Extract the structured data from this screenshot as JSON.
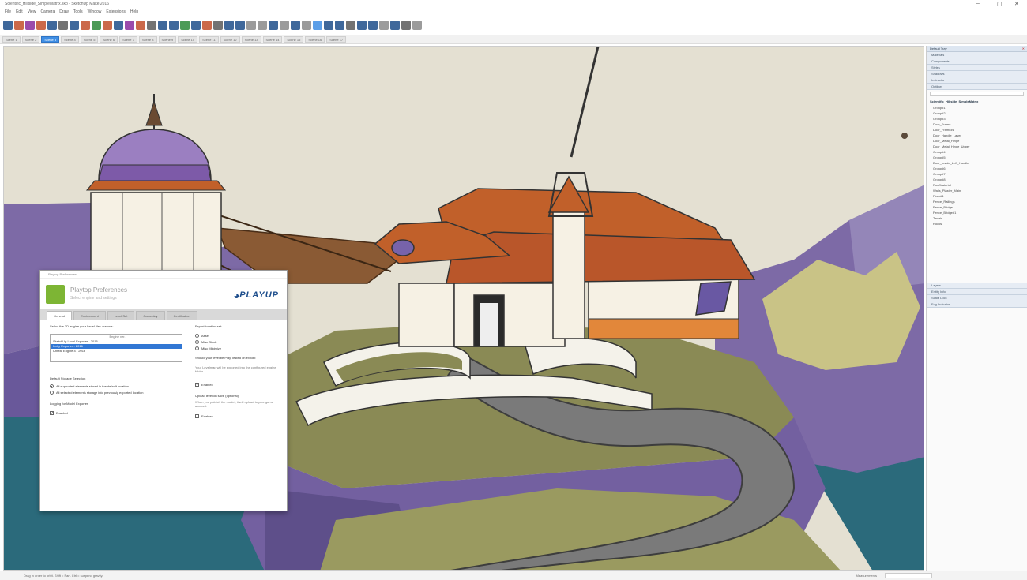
{
  "window": {
    "title": "Scientific_Hillside_SimpleMatrix.skp - SketchUp Make 2016"
  },
  "menu": [
    "File",
    "Edit",
    "View",
    "Camera",
    "Draw",
    "Tools",
    "Window",
    "Extensions",
    "Help"
  ],
  "scenes": {
    "tabs": [
      "Scene 1",
      "Scene 2",
      "Scene 3",
      "Scene 4",
      "Scene 5",
      "Scene 6",
      "Scene 7",
      "Scene 8",
      "Scene 9",
      "Scene 10",
      "Scene 11",
      "Scene 12",
      "Scene 13",
      "Scene 14",
      "Scene 15",
      "Scene 16",
      "Scene 17"
    ],
    "active_index": 2
  },
  "tray": {
    "title": "Default Tray",
    "panels": [
      "Materials",
      "Components",
      "Styles",
      "Shadows",
      "Instructor",
      "Outliner"
    ],
    "outliner_root": "Scientific_Hillside_SimpleMatrix",
    "outliner_items": [
      "Group#1",
      "Group#2",
      "Group#3",
      "Door_Frame",
      "Door_Frame#1",
      "Door_Handle_Layer",
      "Door_Metal_Hinge",
      "Door_Metal_Hinge_Upper",
      "Group#4",
      "Group#5",
      "Door_Inside_Left_Handle",
      "Group#6",
      "Group#7",
      "Group#8",
      "RoofMaterial",
      "Walls_Plaster_Main",
      "Floor#1",
      "Fence_Railings",
      "Fence_Bridge",
      "Fence_Bridge#1",
      "Terrain",
      "Rocks"
    ],
    "bottom_panels": [
      "Layers",
      "Entity Info",
      "Scale Lock",
      "Fog Indicator"
    ]
  },
  "status": {
    "text": "Drag in order to orbit. Shift = Pan. Ctrl = suspend gravity.",
    "measurements_label": "Measurements"
  },
  "dialog": {
    "title": "Playtop Preferences",
    "heading": "Playtop Preferences",
    "subheading": "Select engine and settings",
    "logo_text": "PLAYUP",
    "tabs": [
      "General",
      "Environment",
      "Level Set",
      "Gameplay",
      "Certification"
    ],
    "active_tab": 0,
    "engine_prompt": "Select the 3D engine your Level files are use:",
    "list_header": "Engine ver.",
    "engines": [
      "SketchUp Level Exporter - 2016",
      "Unity Exporter - 2016",
      "Unreal Engine 4 - 2016"
    ],
    "selected_engine": 1,
    "default_storage_label": "Default Storage Selection",
    "storage_options": [
      "All supported elements stored in the default location",
      "All selected elements storage into previously exported location"
    ],
    "logging_label": "Logging for Model Exporter",
    "logging_check": "Enabled",
    "export_location_label": "Export location set:",
    "export_options": [
      "Asset",
      "Misc Stock",
      "Misc Minimize"
    ],
    "auto_label": "Should your level be Play Tested on export:",
    "auto_desc": "Your Levelmap will be exported into the configured engine folder.",
    "auto_check": "Enabled",
    "upload_label": "Upload level on save (optional):",
    "upload_desc": "When you publish the model, it will upload to your game account.",
    "upload_check": "Enabled"
  },
  "colors": {
    "sky": "#e4e0d2",
    "rock_purple": "#7d6aa6",
    "grass": "#8a8a55",
    "roof": "#c1602a",
    "wall": "#f6f1e4",
    "water": "#2b6a7b",
    "path": "#7a7a7a",
    "accent": "#3f8ee4"
  }
}
